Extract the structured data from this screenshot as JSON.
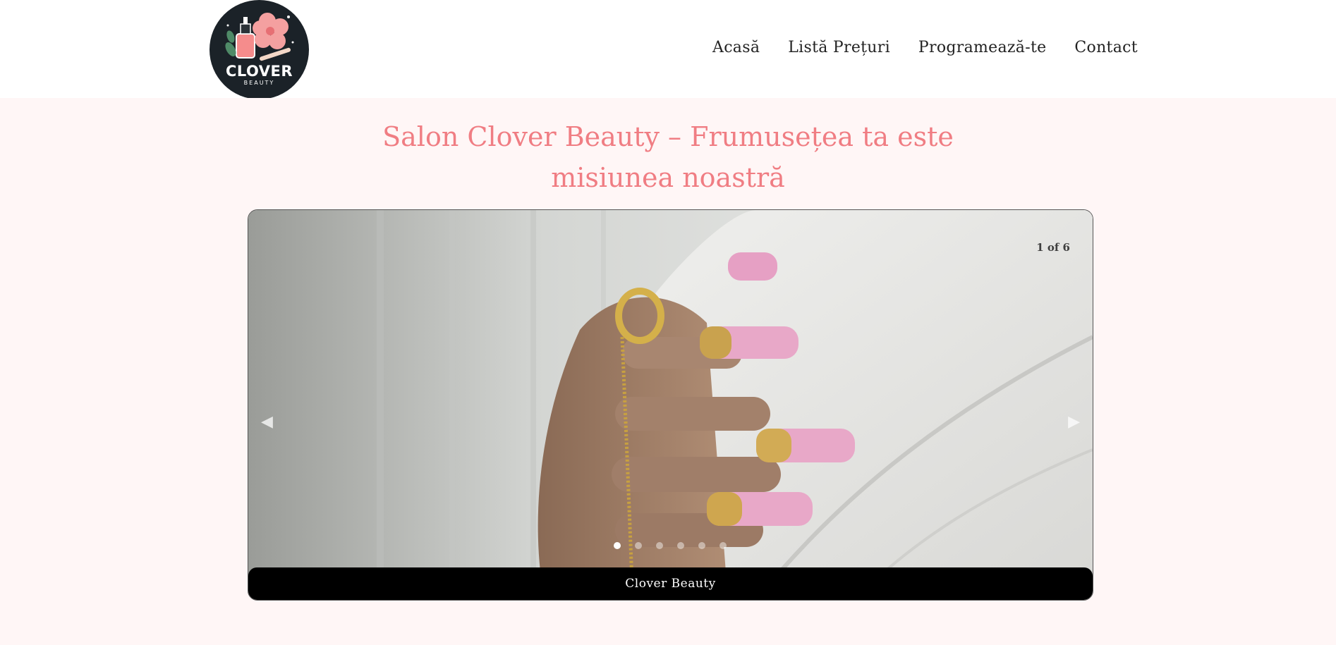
{
  "header": {
    "logo": {
      "name": "CLOVER",
      "subtitle": "BEAUTY"
    },
    "nav": [
      {
        "label": "Acasă"
      },
      {
        "label": "Listă Prețuri"
      },
      {
        "label": "Programează-te"
      },
      {
        "label": "Contact"
      }
    ]
  },
  "main": {
    "title_line1": "Salon Clover Beauty – Frumusețea ta este",
    "title_line2": "misiunea noastră",
    "slider": {
      "counter": "1 of 6",
      "caption": "Clover Beauty",
      "total_slides": 6,
      "active_slide": 1,
      "prev_icon": "chevron-left-icon",
      "next_icon": "chevron-right-icon"
    }
  },
  "colors": {
    "title": "#f07d83",
    "page_background": "#fff6f6",
    "logo_background": "#1b2228",
    "caption_background": "#000000"
  }
}
